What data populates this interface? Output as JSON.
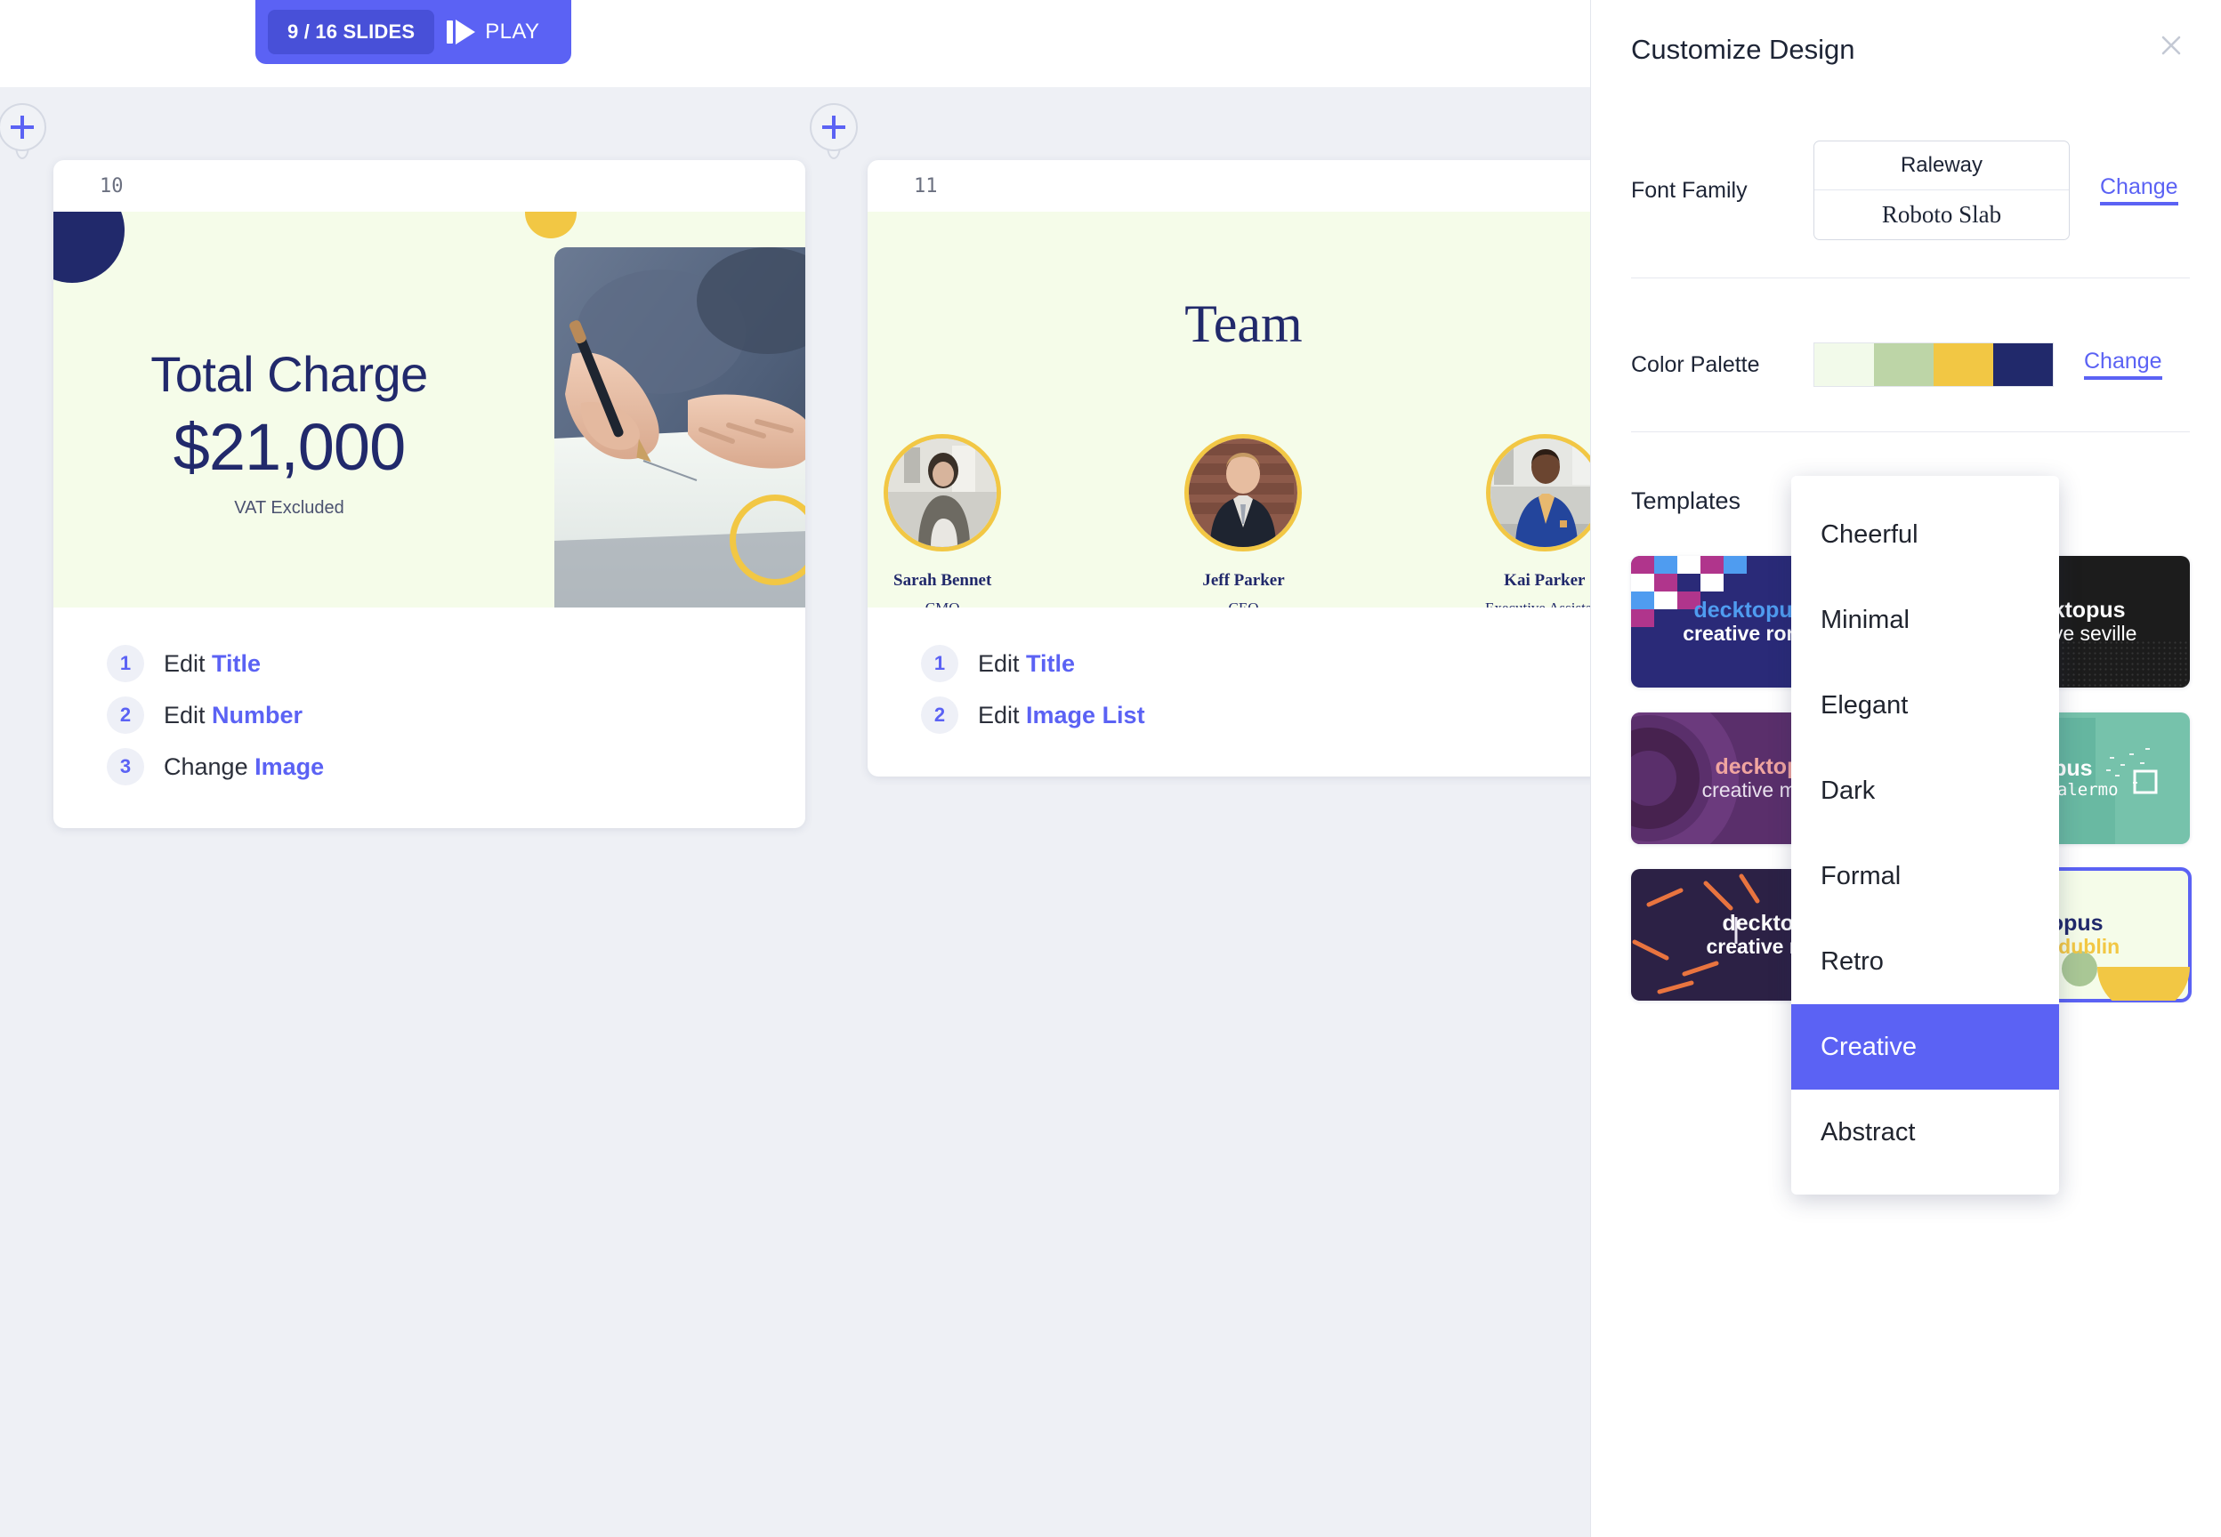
{
  "toolbar": {
    "slide_counter": "9 / 16 SLIDES",
    "play_label": "PLAY",
    "add_slide_icon": "plus-icon"
  },
  "slides": [
    {
      "number": "10",
      "title": "Total Charge",
      "amount": "$21,000",
      "caption": "VAT Excluded",
      "steps": [
        {
          "index": "1",
          "action": "Edit ",
          "target": "Title"
        },
        {
          "index": "2",
          "action": "Edit ",
          "target": "Number"
        },
        {
          "index": "3",
          "action": "Change ",
          "target": "Image"
        }
      ]
    },
    {
      "number": "11",
      "title": "Team",
      "members": [
        {
          "name": "Sarah Bennet",
          "role": "CMO"
        },
        {
          "name": "Jeff Parker",
          "role": "CEO"
        },
        {
          "name": "Kai Parker",
          "role": "Executive Assistant"
        }
      ],
      "steps": [
        {
          "index": "1",
          "action": "Edit ",
          "target": "Title"
        },
        {
          "index": "2",
          "action": "Edit ",
          "target": "Image List"
        }
      ]
    }
  ],
  "panel": {
    "title": "Customize Design",
    "close_icon": "close-icon",
    "font_family": {
      "label": "Font Family",
      "primary": "Raleway",
      "secondary": "Roboto Slab",
      "change_label": "Change"
    },
    "color_palette": {
      "label": "Color Palette",
      "change_label": "Change",
      "swatches": [
        "#f2faea",
        "#bdd5a7",
        "#f2c744",
        "#21296b"
      ]
    },
    "templates": {
      "label": "Templates",
      "items": [
        {
          "brand": "decktopus",
          "sub": "creative rome",
          "bg": "#2a2a78",
          "brand_color": "#4f9cf0",
          "sub_color": "#ffffff",
          "selected": false,
          "style": "checker"
        },
        {
          "brand": "decktopus",
          "sub": "creative seville",
          "bg": "#1c1c1c",
          "brand_color": "#ffffff",
          "sub_color": "#ffffff",
          "selected": false,
          "style": "dot"
        },
        {
          "brand": "decktopus",
          "sub": "creative milano",
          "bg": "#5a2f6b",
          "brand_color": "#f0a5a0",
          "sub_color": "#e9e0ee",
          "selected": false,
          "style": "rings"
        },
        {
          "brand": "decktopus",
          "sub": "creative palermo",
          "bg": "#76c2ab",
          "brand_color": "#ffffff",
          "sub_color": "#ffffff",
          "selected": false,
          "style": "teal"
        },
        {
          "brand": "decktopus",
          "sub": "creative napoli",
          "bg": "#2c2145",
          "brand_color": "#ffffff",
          "sub_color": "#ffffff",
          "selected": false,
          "style": "dashes"
        },
        {
          "brand": "decktopus",
          "sub": "creative dublin",
          "bg": "#f5fce9",
          "brand_color": "#21296b",
          "sub_color": "#f2c744",
          "selected": true,
          "style": "dublin"
        }
      ]
    }
  },
  "dropdown": {
    "items": [
      {
        "label": "Cheerful",
        "selected": false
      },
      {
        "label": "Minimal",
        "selected": false
      },
      {
        "label": "Elegant",
        "selected": false
      },
      {
        "label": "Dark",
        "selected": false
      },
      {
        "label": "Formal",
        "selected": false
      },
      {
        "label": "Retro",
        "selected": false
      },
      {
        "label": "Creative",
        "selected": true
      },
      {
        "label": "Abstract",
        "selected": false
      }
    ]
  },
  "colors": {
    "accent": "#5b62f4",
    "navy": "#21296b",
    "yellow": "#f2c744",
    "slide_bg": "#f5fce9",
    "canvas_bg": "#eef0f5"
  }
}
